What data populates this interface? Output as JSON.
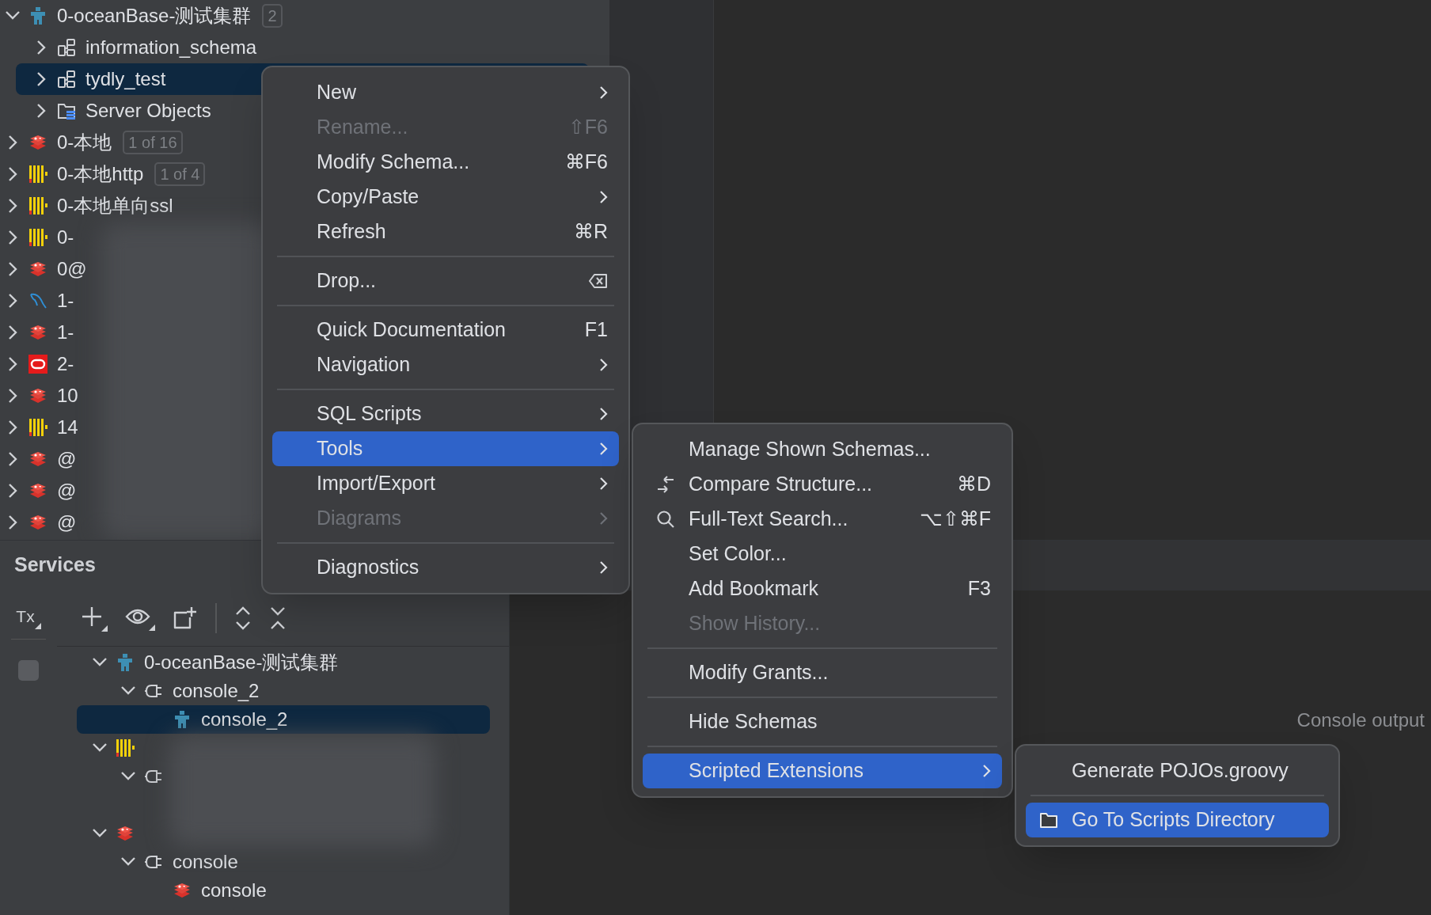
{
  "db_tree": [
    {
      "label": "0-oceanBase-测试集群",
      "badge": "2",
      "kind": "oceanbase",
      "expanded": true,
      "selected": false,
      "children": [
        {
          "label": "information_schema",
          "kind": "schema",
          "expanded": false,
          "selected": false
        },
        {
          "label": "tydly_test",
          "kind": "schema",
          "expanded": false,
          "selected": true
        },
        {
          "label": "Server Objects",
          "kind": "objects",
          "expanded": false,
          "selected": false
        }
      ]
    },
    {
      "label": "0-本地",
      "badge": "1 of 16",
      "kind": "redis",
      "expanded": false,
      "selected": false
    },
    {
      "label": "0-本地http",
      "badge": "1 of 4",
      "kind": "clickhouse",
      "expanded": false,
      "selected": false
    },
    {
      "label": "0-本地单向ssl",
      "kind": "clickhouse",
      "expanded": false,
      "selected": false
    },
    {
      "label": "0-",
      "kind": "clickhouse",
      "expanded": false,
      "selected": false
    },
    {
      "label": "0@",
      "kind": "redis",
      "expanded": false,
      "selected": false
    },
    {
      "label": "1-",
      "kind": "mysql",
      "expanded": false,
      "selected": false
    },
    {
      "label": "1-",
      "kind": "redis",
      "expanded": false,
      "selected": false
    },
    {
      "label": "2-",
      "kind": "oracle",
      "expanded": false,
      "selected": false
    },
    {
      "label": "10",
      "kind": "redis",
      "expanded": false,
      "selected": false
    },
    {
      "label": "14",
      "kind": "clickhouse",
      "expanded": false,
      "selected": false
    },
    {
      "label": "@",
      "kind": "redis",
      "expanded": false,
      "selected": false
    },
    {
      "label": "@",
      "kind": "redis",
      "expanded": false,
      "selected": false
    },
    {
      "label": "@",
      "kind": "redis",
      "expanded": false,
      "selected": false
    }
  ],
  "context_menu": [
    {
      "kind": "item",
      "label": "New",
      "submenu": true,
      "disabled": false,
      "selected": false
    },
    {
      "kind": "item",
      "label": "Rename...",
      "shortcut": "⇧F6",
      "submenu": false,
      "disabled": true,
      "selected": false
    },
    {
      "kind": "item",
      "label": "Modify Schema...",
      "shortcut": "⌘F6",
      "submenu": false,
      "disabled": false,
      "selected": false
    },
    {
      "kind": "item",
      "label": "Copy/Paste",
      "submenu": true,
      "disabled": false,
      "selected": false
    },
    {
      "kind": "item",
      "label": "Refresh",
      "shortcut": "⌘R",
      "submenu": false,
      "disabled": false,
      "selected": false
    },
    {
      "kind": "separator"
    },
    {
      "kind": "delete-key-item",
      "label": "Drop...",
      "submenu": false,
      "disabled": false,
      "selected": false
    },
    {
      "kind": "separator"
    },
    {
      "kind": "item",
      "label": "Quick Documentation",
      "shortcut": "F1",
      "submenu": false,
      "disabled": false,
      "selected": false
    },
    {
      "kind": "item",
      "label": "Navigation",
      "submenu": true,
      "disabled": false,
      "selected": false
    },
    {
      "kind": "separator"
    },
    {
      "kind": "item",
      "label": "SQL Scripts",
      "submenu": true,
      "disabled": false,
      "selected": false
    },
    {
      "kind": "item",
      "label": "Tools",
      "submenu": true,
      "disabled": false,
      "selected": true
    },
    {
      "kind": "item",
      "label": "Import/Export",
      "submenu": true,
      "disabled": false,
      "selected": false
    },
    {
      "kind": "item",
      "label": "Diagrams",
      "submenu": true,
      "disabled": true,
      "selected": false
    },
    {
      "kind": "separator"
    },
    {
      "kind": "item",
      "label": "Diagnostics",
      "submenu": true,
      "disabled": false,
      "selected": false
    }
  ],
  "tools_submenu": [
    {
      "kind": "item",
      "label": "Manage Shown Schemas...",
      "submenu": false,
      "disabled": false,
      "selected": false
    },
    {
      "kind": "compare-item",
      "label": "Compare Structure...",
      "shortcut": "⌘D",
      "submenu": false,
      "disabled": false,
      "selected": false
    },
    {
      "kind": "search-item",
      "label": "Full-Text Search...",
      "shortcut": "⌥⇧⌘F",
      "submenu": false,
      "disabled": false,
      "selected": false
    },
    {
      "kind": "item",
      "label": "Set Color...",
      "submenu": false,
      "disabled": false,
      "selected": false
    },
    {
      "kind": "item",
      "label": "Add Bookmark",
      "shortcut": "F3",
      "submenu": false,
      "disabled": false,
      "selected": false
    },
    {
      "kind": "item",
      "label": "Show History...",
      "submenu": false,
      "disabled": true,
      "selected": false
    },
    {
      "kind": "separator"
    },
    {
      "kind": "item",
      "label": "Modify Grants...",
      "submenu": false,
      "disabled": false,
      "selected": false
    },
    {
      "kind": "separator"
    },
    {
      "kind": "item",
      "label": "Hide Schemas",
      "submenu": false,
      "disabled": false,
      "selected": false
    },
    {
      "kind": "separator"
    },
    {
      "kind": "item",
      "label": "Scripted Extensions",
      "submenu": true,
      "disabled": false,
      "selected": true
    }
  ],
  "scripted_submenu": [
    {
      "kind": "item",
      "label": "Generate POJOs.groovy",
      "submenu": false,
      "disabled": false,
      "selected": false
    },
    {
      "kind": "separator"
    },
    {
      "kind": "folder-item",
      "label": "Go To Scripts Directory",
      "submenu": false,
      "disabled": false,
      "selected": true
    }
  ],
  "services": {
    "title": "Services",
    "tx_label": "Tx",
    "toggle": {
      "checked": false
    },
    "tree": [
      {
        "label": "0-oceanBase-测试集群",
        "kind": "oceanbase",
        "expanded": true,
        "selected": false,
        "children": [
          {
            "label": "console_2",
            "kind": "console",
            "expanded": true,
            "selected": false,
            "children": [
              {
                "label": "console_2",
                "kind": "oceanbase",
                "selected": true
              }
            ]
          }
        ]
      },
      {
        "kind": "clickhouse",
        "expanded": true,
        "selected": false,
        "children": [
          {
            "kind": "console",
            "expanded": true,
            "selected": false
          }
        ]
      },
      {
        "kind": "redis",
        "expanded": true,
        "selected": false,
        "children": [
          {
            "label": "console",
            "kind": "console",
            "expanded": true,
            "selected": false,
            "children": [
              {
                "label": "console",
                "kind": "redis",
                "selected": false
              }
            ]
          }
        ]
      }
    ]
  },
  "console_empty_text": "Console output"
}
